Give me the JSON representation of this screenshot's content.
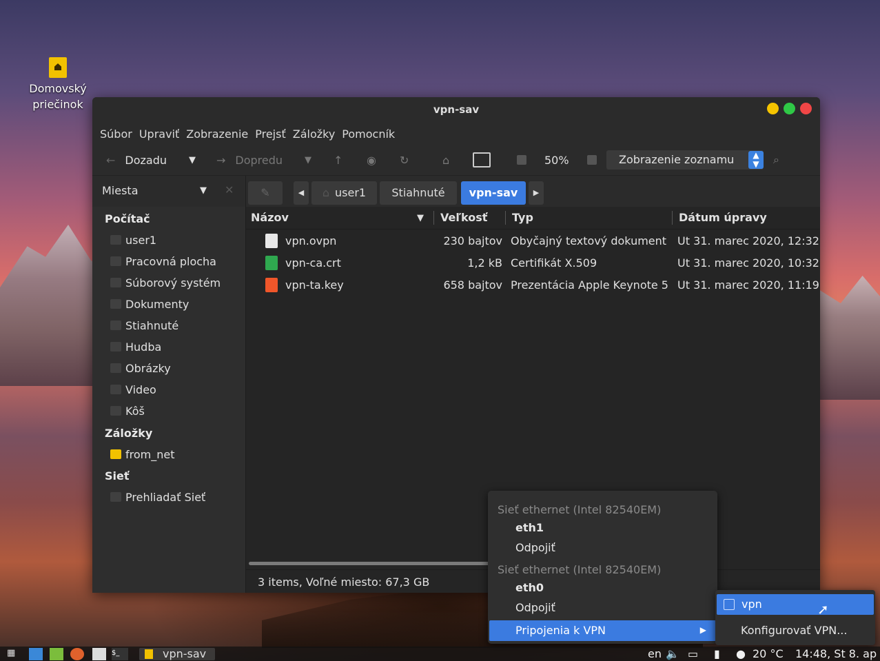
{
  "desktop": {
    "home_icon_label_1": "Domovský",
    "home_icon_label_2": "priečinok"
  },
  "window": {
    "title": "vpn-sav",
    "controls": {
      "minimize_color": "#f5c400",
      "maximize_color": "#2fc846",
      "close_color": "#f04646"
    }
  },
  "menubar": [
    "Súbor",
    "Upraviť",
    "Zobrazenie",
    "Prejsť",
    "Záložky",
    "Pomocník"
  ],
  "toolbar": {
    "back_label": "Dozadu",
    "forward_label": "Dopredu",
    "zoom": "50%",
    "view_mode": "Zobrazenie zoznamu"
  },
  "location": {
    "places_label": "Miesta",
    "crumbs": [
      "user1",
      "Stiahnuté",
      "vpn-sav"
    ]
  },
  "sidebar": {
    "computer_header": "Počítač",
    "computer_items": [
      "user1",
      "Pracovná plocha",
      "Súborový systém",
      "Dokumenty",
      "Stiahnuté",
      "Hudba",
      "Obrázky",
      "Video",
      "Kôš"
    ],
    "bookmarks_header": "Záložky",
    "bookmarks_items": [
      "from_net"
    ],
    "network_header": "Sieť",
    "network_items": [
      "Prehliadať Sieť"
    ]
  },
  "columns": {
    "name": "Názov",
    "size": "Veľkosť",
    "type": "Typ",
    "modified": "Dátum úpravy"
  },
  "files": [
    {
      "name": "vpn.ovpn",
      "size": "230 bajtov",
      "type": "Obyčajný textový dokument",
      "modified": "Ut 31. marec 2020, 12:32:"
    },
    {
      "name": "vpn-ca.crt",
      "size": "1,2 kB",
      "type": "Certifikát X.509",
      "modified": "Ut 31. marec 2020, 10:32:"
    },
    {
      "name": "vpn-ta.key",
      "size": "658 bajtov",
      "type": "Prezentácia Apple Keynote 5",
      "modified": "Ut 31. marec 2020, 11:19:"
    }
  ],
  "statusbar": {
    "text": "3 items, Voľné miesto: 67,3 GB"
  },
  "network_menu": {
    "eth1_header": "Sieť ethernet (Intel 82540EM)",
    "eth1_name": "eth1",
    "eth1_action": "Odpojiť",
    "eth0_header": "Sieť ethernet (Intel 82540EM)",
    "eth0_name": "eth0",
    "eth0_action": "Odpojiť",
    "vpn_label": "Pripojenia k VPN"
  },
  "vpn_submenu": {
    "vpn_item": "vpn",
    "configure": "Konfigurovať VPN..."
  },
  "taskbar": {
    "task_label": "vpn-sav",
    "keyboard_layout": "en",
    "weather": "20 °C",
    "clock": "14:48, St 8. ap"
  }
}
